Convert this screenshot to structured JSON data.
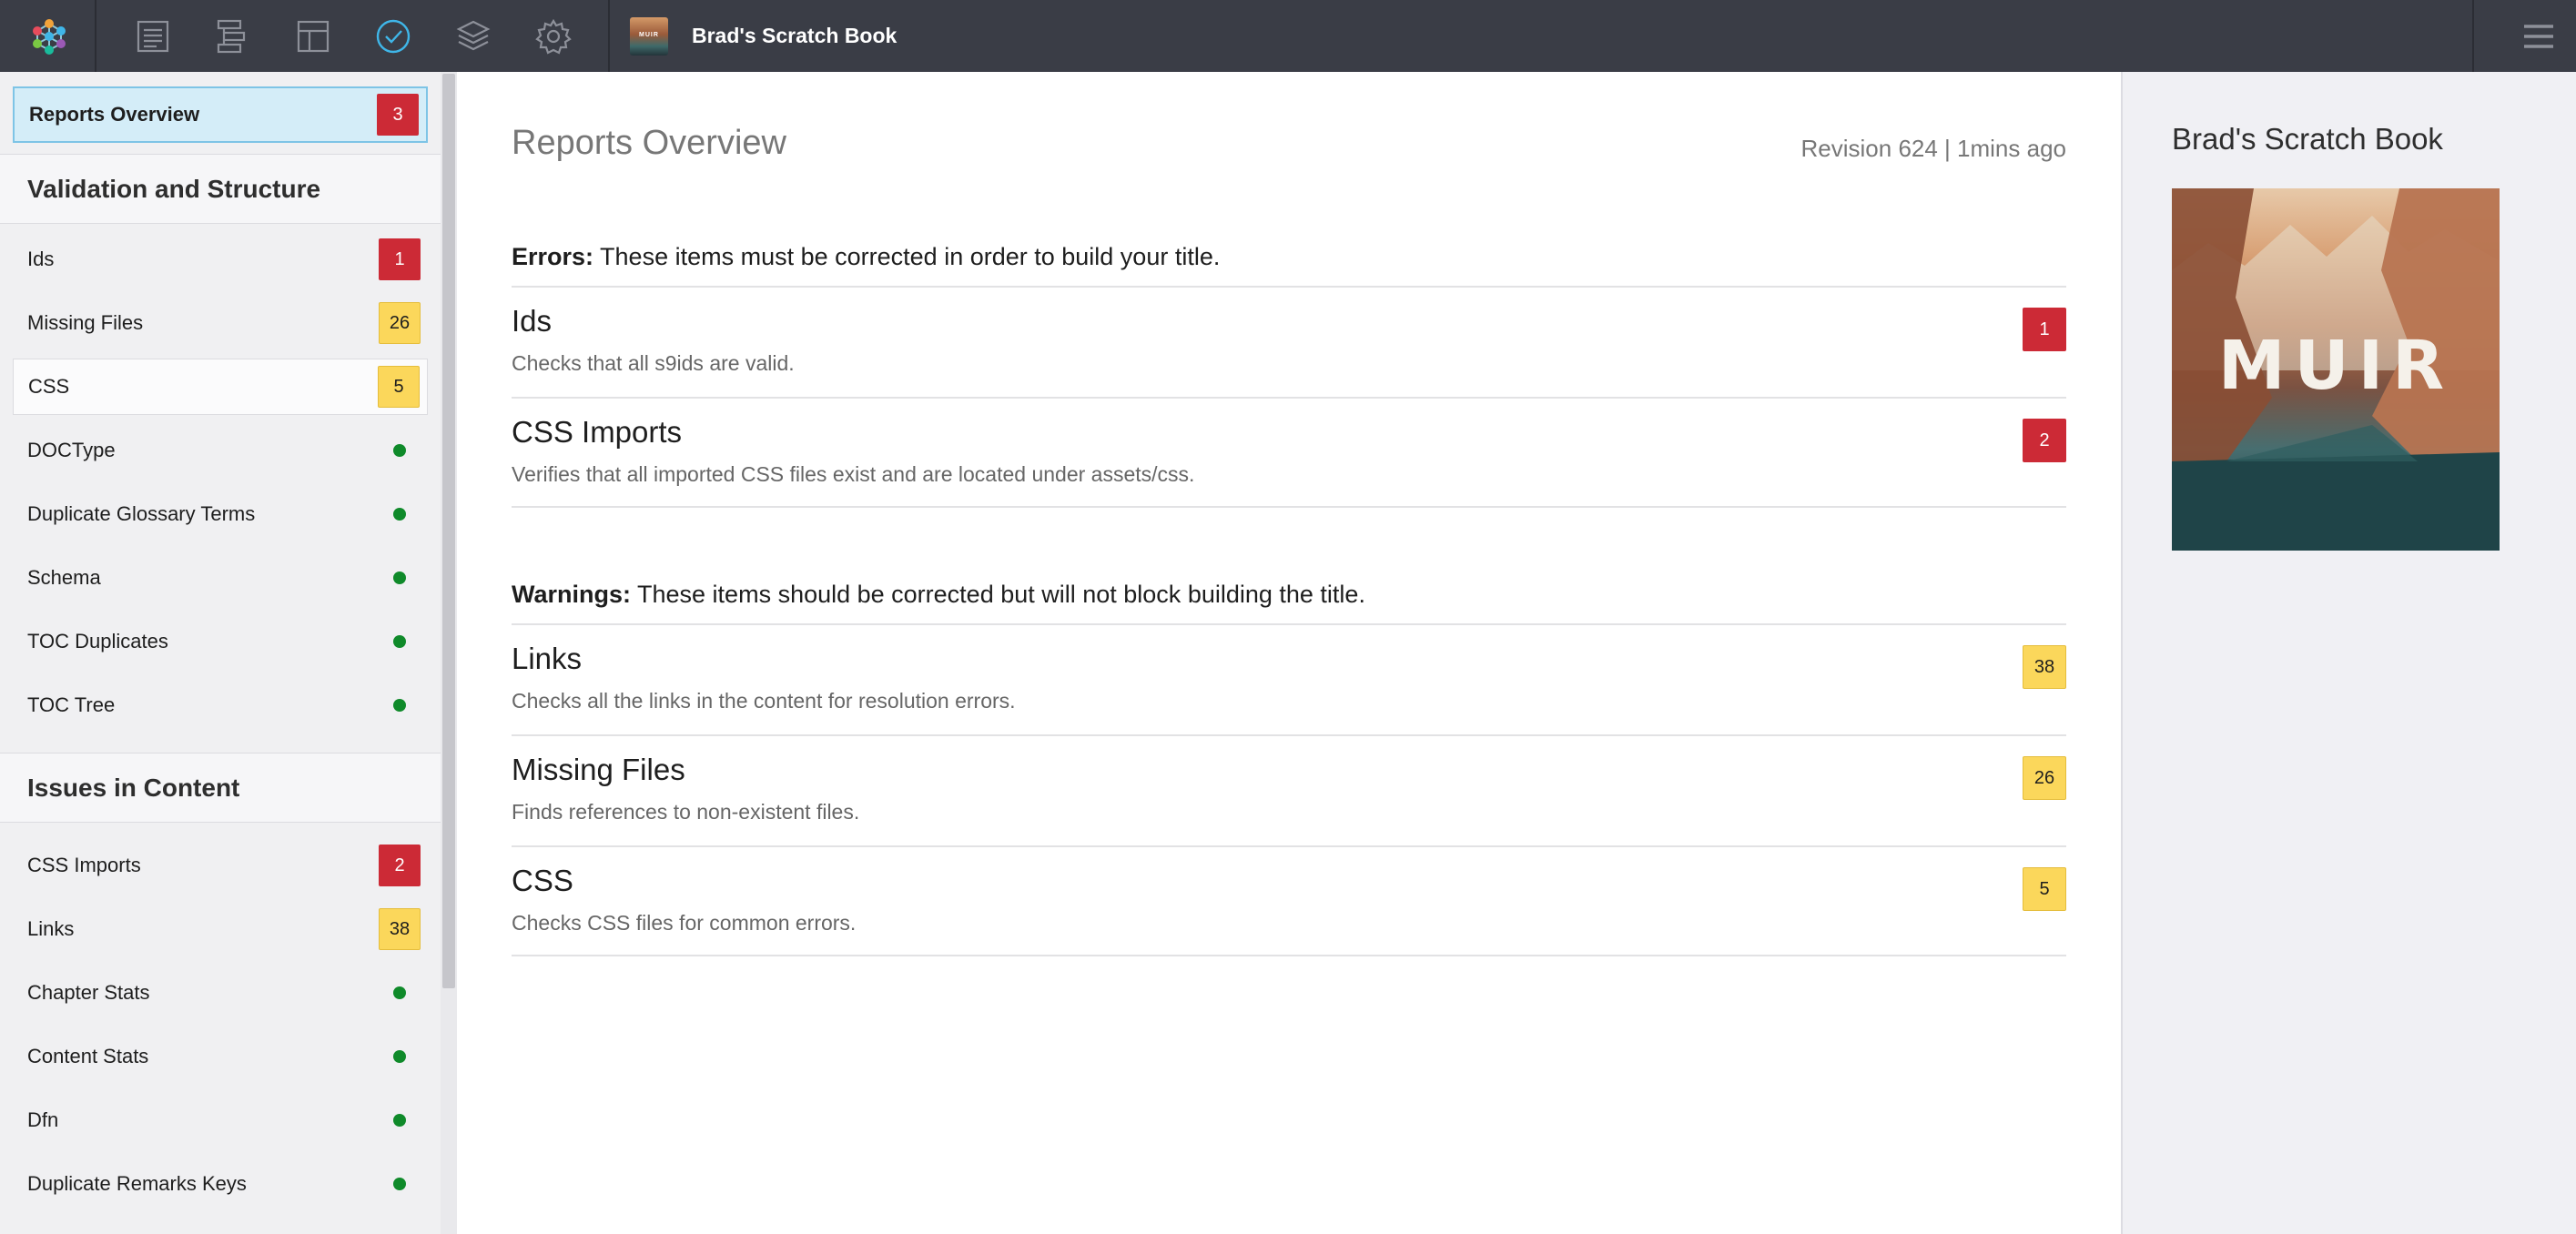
{
  "topbar": {
    "book_title": "Brad's Scratch Book",
    "thumb_text": "MUIR",
    "icons": [
      "app-logo-icon",
      "document-icon",
      "structure-icon",
      "layout-icon",
      "check-circle-icon",
      "layers-icon",
      "gear-icon",
      "hamburger-menu-icon"
    ],
    "active_icon": "check-circle-icon",
    "active_color": "#3fb6e8"
  },
  "sidebar": {
    "selected": {
      "label": "Reports Overview",
      "count": "3"
    },
    "sections": [
      {
        "heading": "Validation and Structure",
        "items": [
          {
            "label": "Ids",
            "count": "1",
            "status": "error"
          },
          {
            "label": "Missing Files",
            "count": "26",
            "status": "warning"
          },
          {
            "label": "CSS",
            "count": "5",
            "status": "warning"
          },
          {
            "label": "DOCType",
            "status": "ok"
          },
          {
            "label": "Duplicate Glossary Terms",
            "status": "ok"
          },
          {
            "label": "Schema",
            "status": "ok"
          },
          {
            "label": "TOC Duplicates",
            "status": "ok"
          },
          {
            "label": "TOC Tree",
            "status": "ok"
          }
        ]
      },
      {
        "heading": "Issues in Content",
        "items": [
          {
            "label": "CSS Imports",
            "count": "2",
            "status": "error"
          },
          {
            "label": "Links",
            "count": "38",
            "status": "warning"
          },
          {
            "label": "Chapter Stats",
            "status": "ok"
          },
          {
            "label": "Content Stats",
            "status": "ok"
          },
          {
            "label": "Dfn",
            "status": "ok"
          },
          {
            "label": "Duplicate Remarks Keys",
            "status": "ok"
          }
        ]
      }
    ]
  },
  "main": {
    "title": "Reports Overview",
    "revision": "Revision 624 | 1mins ago",
    "errors": {
      "label": "Errors:",
      "text": "These items must be corrected in order to build your title.",
      "rows": [
        {
          "title": "Ids",
          "desc": "Checks that all s9ids are valid.",
          "count": "1"
        },
        {
          "title": "CSS Imports",
          "desc": "Verifies that all imported CSS files exist and are located under assets/css.",
          "count": "2"
        }
      ]
    },
    "warnings": {
      "label": "Warnings:",
      "text": "These items should be corrected but will not block building the title.",
      "rows": [
        {
          "title": "Links",
          "desc": "Checks all the links in the content for resolution errors.",
          "count": "38"
        },
        {
          "title": "Missing Files",
          "desc": "Finds references to non-existent files.",
          "count": "26"
        },
        {
          "title": "CSS",
          "desc": "Checks CSS files for common errors.",
          "count": "5"
        }
      ]
    }
  },
  "right_panel": {
    "title": "Brad's Scratch Book",
    "cover_text": "MUIR"
  }
}
